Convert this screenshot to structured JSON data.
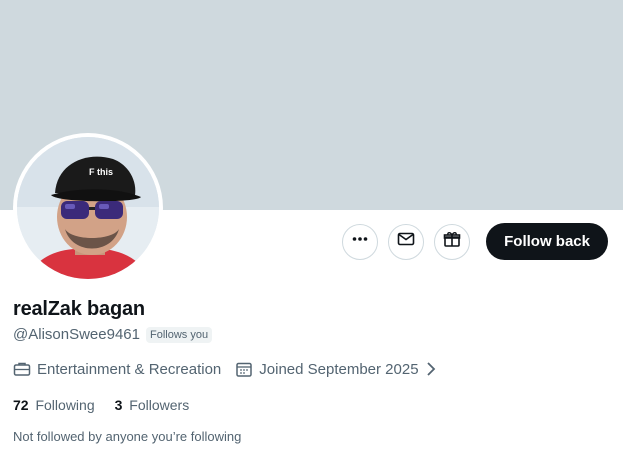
{
  "profile": {
    "display_name": "realZak bagan",
    "handle": "@AlisonSwee9461",
    "follows_you_badge": "Follows you",
    "category": "Entertainment & Recreation",
    "joined": "Joined September 2025",
    "following_count": "72",
    "following_label": "Following",
    "followers_count": "3",
    "followers_label": "Followers",
    "not_followed_note": "Not followed by anyone you’re following",
    "cap_text": "F this"
  },
  "actions": {
    "more_icon": "more-horizontal-icon",
    "message_icon": "envelope-icon",
    "gift_icon": "gift-icon",
    "follow_back_label": "Follow back"
  },
  "colors": {
    "banner": "#cfd9de",
    "primary_text": "#0f1419",
    "secondary_text": "#536471",
    "follow_button_bg": "#0f1419"
  }
}
